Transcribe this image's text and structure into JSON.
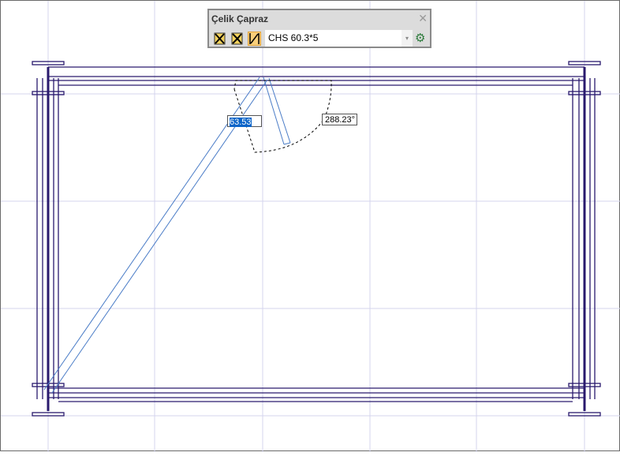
{
  "toolbar": {
    "title": "Çelik Çapraz",
    "close_label": "✕",
    "buttons": [
      {
        "name": "x-brace",
        "active": false
      },
      {
        "name": "k-brace",
        "active": false
      },
      {
        "name": "single-diagonal",
        "active": true
      }
    ],
    "profile_value": "CHS 60.3*5",
    "dropdown_icon": "▾",
    "settings_icon": "gear-icon"
  },
  "drawing": {
    "length_input": "63.53",
    "angle_label": "288.23°"
  },
  "colors": {
    "frame": "#2a1a6e",
    "brace": "#4a7cc7",
    "grid": "#d0d0ec"
  }
}
